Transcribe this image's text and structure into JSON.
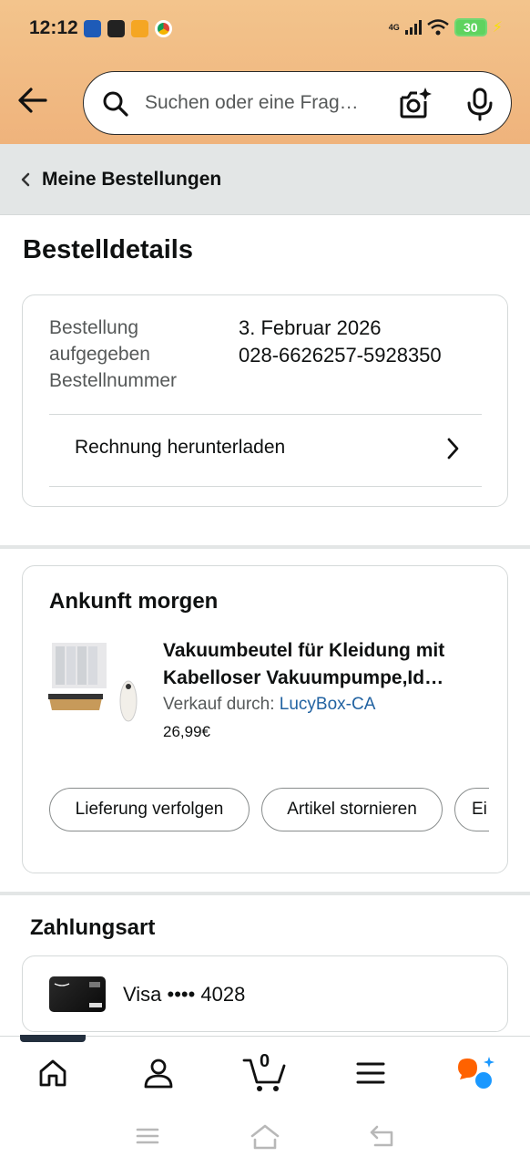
{
  "status_bar": {
    "time": "12:12",
    "network": "4G",
    "battery": "30",
    "app_icon_colors": [
      "#1e5bb8",
      "#222222",
      "#f5a623",
      "#db4437"
    ]
  },
  "header": {
    "search_placeholder": "Suchen oder eine Frag…",
    "icons": [
      "back-arrow-icon",
      "search-icon",
      "camera-sparkle-icon",
      "microphone-icon"
    ]
  },
  "breadcrumb": {
    "label": "Meine Bestellungen"
  },
  "page": {
    "title": "Bestelldetails"
  },
  "order_info": {
    "placed_label_line1": "Bestellung",
    "placed_label_line2": "aufgegeben",
    "placed_value": "3. Februar 2026",
    "number_label": "Bestellnummer",
    "number_value": "028-6626257-5928350",
    "invoice_label": "Rechnung herunterladen"
  },
  "shipment": {
    "status": "Ankunft morgen",
    "product_title_line1": "Vakuumbeutel für Kleidung mit",
    "product_title_line2": "Kabelloser Vakuumpumpe,Id…",
    "seller_prefix": "Verkauf durch: ",
    "seller_name": "LucyBox-CA",
    "price": "26,99€",
    "actions": [
      "Lieferung verfolgen",
      "Artikel stornieren",
      "Ei"
    ]
  },
  "payment": {
    "title": "Zahlungsart",
    "method": "Visa •••• 4028"
  },
  "bottom_nav": {
    "cart_count": "0",
    "items": [
      "home-icon",
      "account-icon",
      "cart-icon",
      "menu-icon",
      "rufus-chat-icon"
    ]
  },
  "colors": {
    "header_bg": "#f3c48c",
    "link": "#2162a1",
    "accent_orange": "#ff6200",
    "accent_blue": "#1a98ff"
  }
}
